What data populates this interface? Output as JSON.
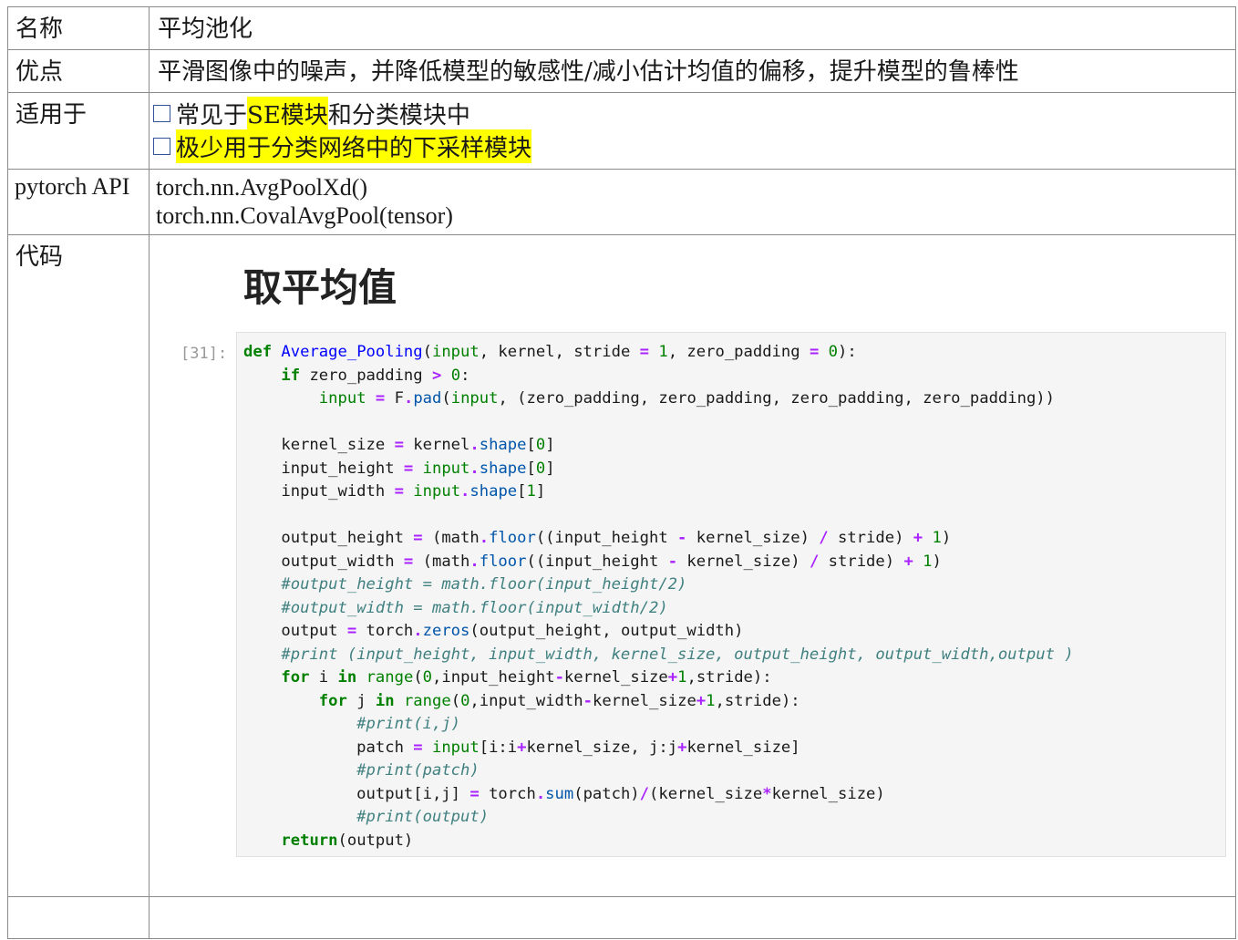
{
  "table": {
    "rows": {
      "name": {
        "label": "名称",
        "value": "平均池化"
      },
      "advantages": {
        "label": "优点",
        "value": "平滑图像中的噪声，并降低模型的敏感性/减小估计均值的偏移，提升模型的鲁棒性"
      },
      "applicable": {
        "label": "适用于",
        "items": [
          {
            "before": "常见于",
            "highlight": "SE模块",
            "after": "和分类模块中"
          },
          {
            "before": "",
            "highlight": "极少用于分类网络中的下采样模块",
            "after": ""
          }
        ]
      },
      "api": {
        "label": "pytorch API",
        "lines": [
          "torch.nn.AvgPoolXd()",
          "torch.nn.CovalAvgPool(tensor)"
        ]
      },
      "code": {
        "label": "代码",
        "heading": "取平均值",
        "prompt": "[31]:"
      },
      "empty": {
        "label": "",
        "value": ""
      }
    }
  },
  "code_lines": [
    [
      [
        "kw",
        "def"
      ],
      [
        "plain",
        " "
      ],
      [
        "fn",
        "Average_Pooling"
      ],
      [
        "plain",
        "("
      ],
      [
        "bi",
        "input"
      ],
      [
        "plain",
        ", kernel, stride "
      ],
      [
        "op",
        "="
      ],
      [
        "plain",
        " "
      ],
      [
        "num",
        "1"
      ],
      [
        "plain",
        ", zero_padding "
      ],
      [
        "op",
        "="
      ],
      [
        "plain",
        " "
      ],
      [
        "num",
        "0"
      ],
      [
        "plain",
        "):"
      ]
    ],
    [
      [
        "plain",
        "    "
      ],
      [
        "kw",
        "if"
      ],
      [
        "plain",
        " zero_padding "
      ],
      [
        "op",
        ">"
      ],
      [
        "plain",
        " "
      ],
      [
        "num",
        "0"
      ],
      [
        "plain",
        ":"
      ]
    ],
    [
      [
        "plain",
        "        "
      ],
      [
        "bi",
        "input"
      ],
      [
        "plain",
        " "
      ],
      [
        "op",
        "="
      ],
      [
        "plain",
        " F"
      ],
      [
        "op",
        "."
      ],
      [
        "attr",
        "pad"
      ],
      [
        "plain",
        "("
      ],
      [
        "bi",
        "input"
      ],
      [
        "plain",
        ", (zero_padding, zero_padding, zero_padding, zero_padding))"
      ]
    ],
    [
      [
        "plain",
        ""
      ]
    ],
    [
      [
        "plain",
        "    kernel_size "
      ],
      [
        "op",
        "="
      ],
      [
        "plain",
        " kernel"
      ],
      [
        "op",
        "."
      ],
      [
        "attr",
        "shape"
      ],
      [
        "plain",
        "["
      ],
      [
        "num",
        "0"
      ],
      [
        "plain",
        "]"
      ]
    ],
    [
      [
        "plain",
        "    input_height "
      ],
      [
        "op",
        "="
      ],
      [
        "plain",
        " "
      ],
      [
        "bi",
        "input"
      ],
      [
        "op",
        "."
      ],
      [
        "attr",
        "shape"
      ],
      [
        "plain",
        "["
      ],
      [
        "num",
        "0"
      ],
      [
        "plain",
        "]"
      ]
    ],
    [
      [
        "plain",
        "    input_width "
      ],
      [
        "op",
        "="
      ],
      [
        "plain",
        " "
      ],
      [
        "bi",
        "input"
      ],
      [
        "op",
        "."
      ],
      [
        "attr",
        "shape"
      ],
      [
        "plain",
        "["
      ],
      [
        "num",
        "1"
      ],
      [
        "plain",
        "]"
      ]
    ],
    [
      [
        "plain",
        ""
      ]
    ],
    [
      [
        "plain",
        "    output_height "
      ],
      [
        "op",
        "="
      ],
      [
        "plain",
        " (math"
      ],
      [
        "op",
        "."
      ],
      [
        "attr",
        "floor"
      ],
      [
        "plain",
        "((input_height "
      ],
      [
        "op",
        "-"
      ],
      [
        "plain",
        " kernel_size) "
      ],
      [
        "op",
        "/"
      ],
      [
        "plain",
        " stride) "
      ],
      [
        "op",
        "+"
      ],
      [
        "plain",
        " "
      ],
      [
        "num",
        "1"
      ],
      [
        "plain",
        ")"
      ]
    ],
    [
      [
        "plain",
        "    output_width "
      ],
      [
        "op",
        "="
      ],
      [
        "plain",
        " (math"
      ],
      [
        "op",
        "."
      ],
      [
        "attr",
        "floor"
      ],
      [
        "plain",
        "((input_height "
      ],
      [
        "op",
        "-"
      ],
      [
        "plain",
        " kernel_size) "
      ],
      [
        "op",
        "/"
      ],
      [
        "plain",
        " stride) "
      ],
      [
        "op",
        "+"
      ],
      [
        "plain",
        " "
      ],
      [
        "num",
        "1"
      ],
      [
        "plain",
        ")"
      ]
    ],
    [
      [
        "plain",
        "    "
      ],
      [
        "com",
        "#output_height = math.floor(input_height/2)"
      ]
    ],
    [
      [
        "plain",
        "    "
      ],
      [
        "com",
        "#output_width = math.floor(input_width/2)"
      ]
    ],
    [
      [
        "plain",
        "    output "
      ],
      [
        "op",
        "="
      ],
      [
        "plain",
        " torch"
      ],
      [
        "op",
        "."
      ],
      [
        "attr",
        "zeros"
      ],
      [
        "plain",
        "(output_height, output_width)"
      ]
    ],
    [
      [
        "plain",
        "    "
      ],
      [
        "com",
        "#print (input_height, input_width, kernel_size, output_height, output_width,output )"
      ]
    ],
    [
      [
        "plain",
        "    "
      ],
      [
        "kw",
        "for"
      ],
      [
        "plain",
        " i "
      ],
      [
        "kw",
        "in"
      ],
      [
        "plain",
        " "
      ],
      [
        "bi",
        "range"
      ],
      [
        "plain",
        "("
      ],
      [
        "num",
        "0"
      ],
      [
        "plain",
        ",input_height"
      ],
      [
        "op",
        "-"
      ],
      [
        "plain",
        "kernel_size"
      ],
      [
        "op",
        "+"
      ],
      [
        "num",
        "1"
      ],
      [
        "plain",
        ",stride):"
      ]
    ],
    [
      [
        "plain",
        "        "
      ],
      [
        "kw",
        "for"
      ],
      [
        "plain",
        " j "
      ],
      [
        "kw",
        "in"
      ],
      [
        "plain",
        " "
      ],
      [
        "bi",
        "range"
      ],
      [
        "plain",
        "("
      ],
      [
        "num",
        "0"
      ],
      [
        "plain",
        ",input_width"
      ],
      [
        "op",
        "-"
      ],
      [
        "plain",
        "kernel_size"
      ],
      [
        "op",
        "+"
      ],
      [
        "num",
        "1"
      ],
      [
        "plain",
        ",stride):"
      ]
    ],
    [
      [
        "plain",
        "            "
      ],
      [
        "com",
        "#print(i,j)"
      ]
    ],
    [
      [
        "plain",
        "            patch "
      ],
      [
        "op",
        "="
      ],
      [
        "plain",
        " "
      ],
      [
        "bi",
        "input"
      ],
      [
        "plain",
        "[i:i"
      ],
      [
        "op",
        "+"
      ],
      [
        "plain",
        "kernel_size, j:j"
      ],
      [
        "op",
        "+"
      ],
      [
        "plain",
        "kernel_size]"
      ]
    ],
    [
      [
        "plain",
        "            "
      ],
      [
        "com",
        "#print(patch)"
      ]
    ],
    [
      [
        "plain",
        "            output[i,j] "
      ],
      [
        "op",
        "="
      ],
      [
        "plain",
        " torch"
      ],
      [
        "op",
        "."
      ],
      [
        "attr",
        "sum"
      ],
      [
        "plain",
        "(patch)"
      ],
      [
        "op",
        "/"
      ],
      [
        "plain",
        "(kernel_size"
      ],
      [
        "op",
        "*"
      ],
      [
        "plain",
        "kernel_size)"
      ]
    ],
    [
      [
        "plain",
        "            "
      ],
      [
        "com",
        "#print(output)"
      ]
    ],
    [
      [
        "plain",
        "    "
      ],
      [
        "kw",
        "return"
      ],
      [
        "plain",
        "(output)"
      ]
    ]
  ]
}
